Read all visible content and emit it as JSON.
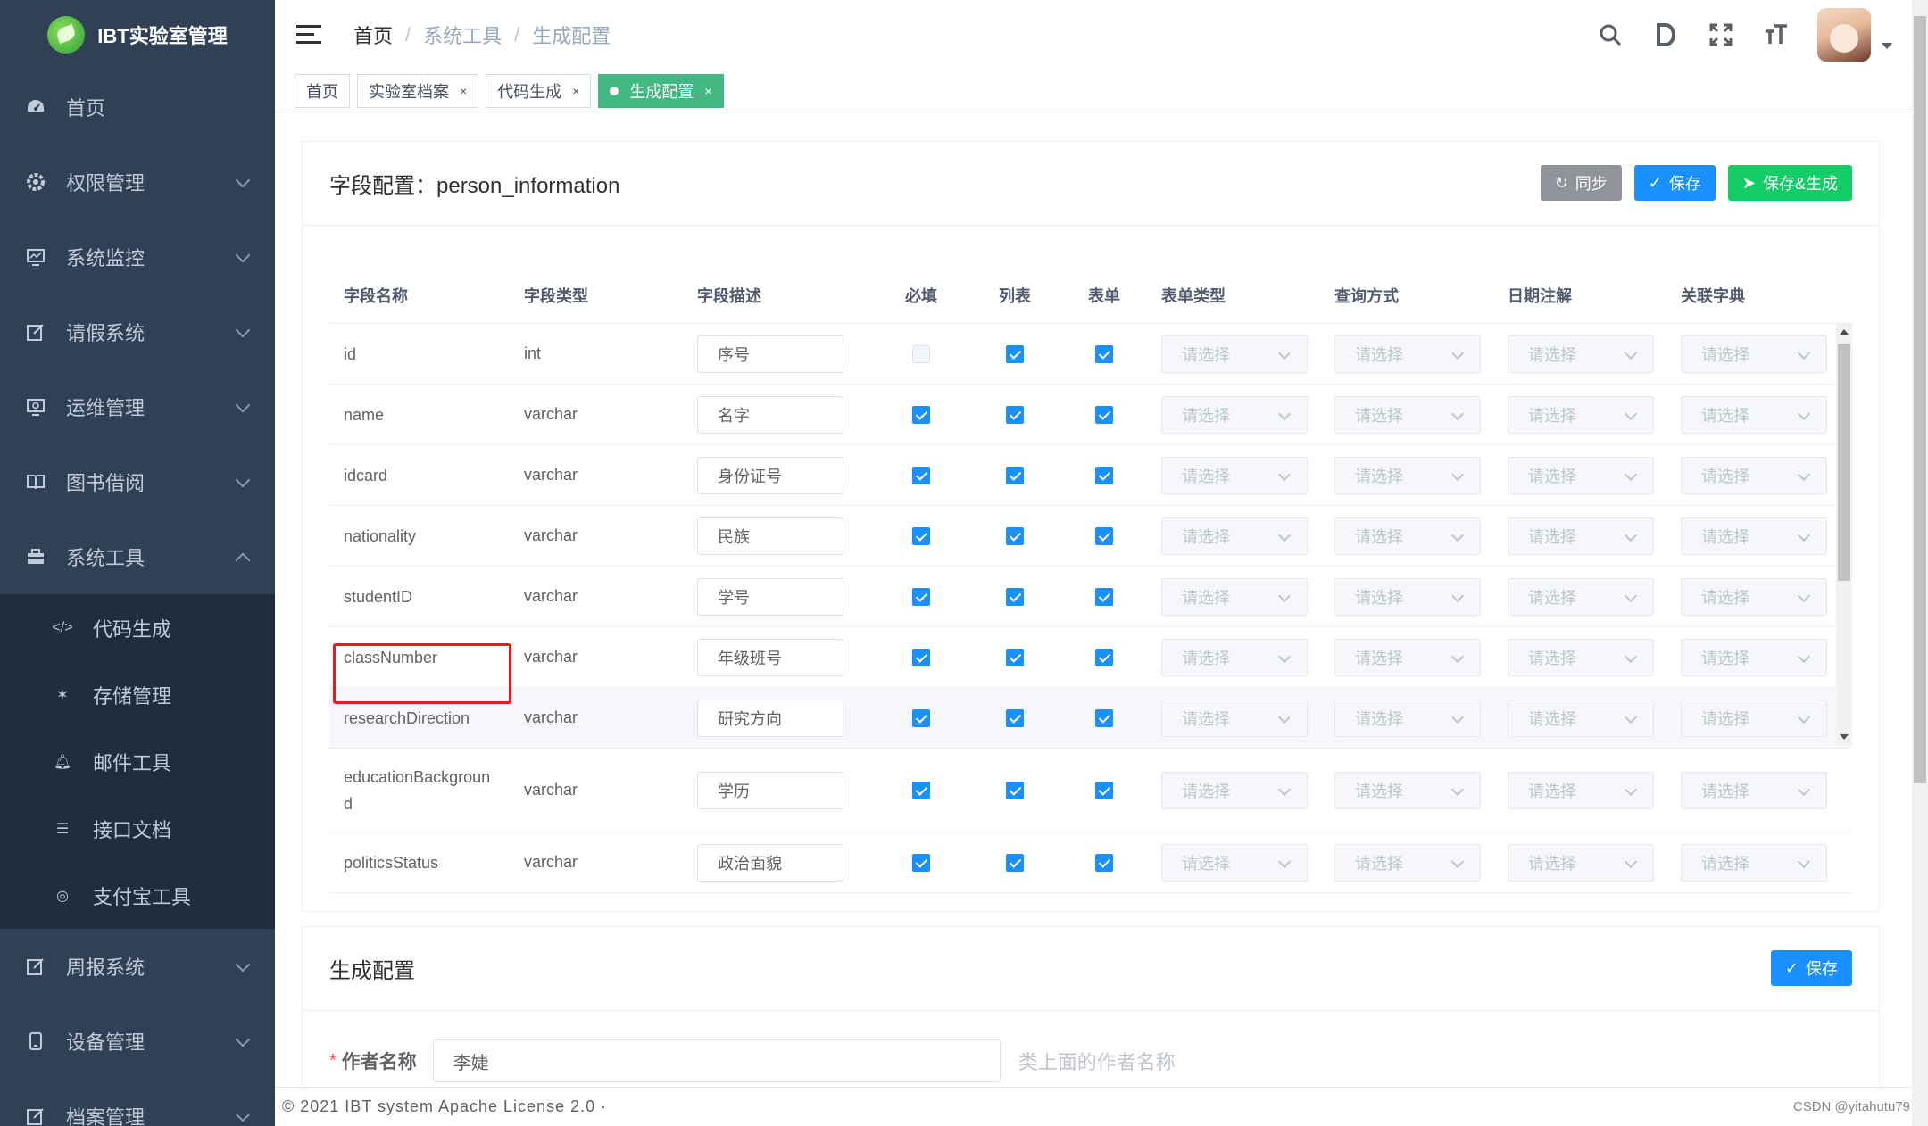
{
  "app": {
    "logo_text": "IBT实验室管理"
  },
  "sidebar": {
    "items": [
      {
        "label": "首页",
        "icon": "dashboard-icon"
      },
      {
        "label": "权限管理",
        "icon": "gear-icon"
      },
      {
        "label": "系统监控",
        "icon": "monitor-icon"
      },
      {
        "label": "请假系统",
        "icon": "edit-icon"
      },
      {
        "label": "运维管理",
        "icon": "screen-icon"
      },
      {
        "label": "图书借阅",
        "icon": "book-icon"
      },
      {
        "label": "系统工具",
        "icon": "toolbox-icon",
        "expanded": true
      }
    ],
    "subitems": [
      {
        "label": "代码生成",
        "icon": "code-icon"
      },
      {
        "label": "存储管理",
        "icon": "storage-icon"
      },
      {
        "label": "邮件工具",
        "icon": "bell-icon"
      },
      {
        "label": "接口文档",
        "icon": "document-icon"
      },
      {
        "label": "支付宝工具",
        "icon": "alipay-icon"
      }
    ],
    "bottom_items": [
      {
        "label": "周报系统",
        "icon": "edit-icon"
      },
      {
        "label": "设备管理",
        "icon": "device-icon"
      },
      {
        "label": "档案管理",
        "icon": "edit-icon"
      }
    ]
  },
  "header": {
    "breadcrumb": [
      "首页",
      "系统工具",
      "生成配置"
    ],
    "icons": [
      "search-icon",
      "doc-icon",
      "fullscreen-icon",
      "font-size-icon"
    ]
  },
  "tags": [
    {
      "label": "首页",
      "active": false,
      "closable": false
    },
    {
      "label": "实验室档案",
      "active": false,
      "closable": true
    },
    {
      "label": "代码生成",
      "active": false,
      "closable": true
    },
    {
      "label": "生成配置",
      "active": true,
      "closable": true
    }
  ],
  "field_config": {
    "title": "字段配置：person_information",
    "buttons": {
      "sync": "同步",
      "save": "保存",
      "save_generate": "保存&生成"
    },
    "columns": [
      "字段名称",
      "字段类型",
      "字段描述",
      "必填",
      "列表",
      "表单",
      "表单类型",
      "查询方式",
      "日期注解",
      "关联字典"
    ],
    "select_placeholder": "请选择",
    "rows": [
      {
        "name": "id",
        "type": "int",
        "desc": "序号",
        "required": false,
        "list": true,
        "form": true
      },
      {
        "name": "name",
        "type": "varchar",
        "desc": "名字",
        "required": true,
        "list": true,
        "form": true
      },
      {
        "name": "idcard",
        "type": "varchar",
        "desc": "身份证号",
        "required": true,
        "list": true,
        "form": true
      },
      {
        "name": "nationality",
        "type": "varchar",
        "desc": "民族",
        "required": true,
        "list": true,
        "form": true
      },
      {
        "name": "studentID",
        "type": "varchar",
        "desc": "学号",
        "required": true,
        "list": true,
        "form": true
      },
      {
        "name": "classNumber",
        "type": "varchar",
        "desc": "年级班号",
        "required": true,
        "list": true,
        "form": true
      },
      {
        "name": "researchDirection",
        "type": "varchar",
        "desc": "研究方向",
        "required": true,
        "list": true,
        "form": true
      },
      {
        "name": "educationBackgroun\nd",
        "type": "varchar",
        "desc": "学历",
        "required": true,
        "list": true,
        "form": true
      },
      {
        "name": "politicsStatus",
        "type": "varchar",
        "desc": "政治面貌",
        "required": true,
        "list": true,
        "form": true
      }
    ]
  },
  "gen_config": {
    "title": "生成配置",
    "save": "保存",
    "author_label": "作者名称",
    "author_value": "李婕",
    "author_tip": "类上面的作者名称"
  },
  "footer": {
    "text": "© 2021 IBT system Apache License 2.0 ·"
  },
  "watermark": "CSDN @yitahutu79",
  "colors": {
    "sidebar": "#304156",
    "submenu": "#1f2d3d",
    "primary": "#1890ff",
    "success": "#13ce66",
    "tag_active": "#42b983"
  }
}
